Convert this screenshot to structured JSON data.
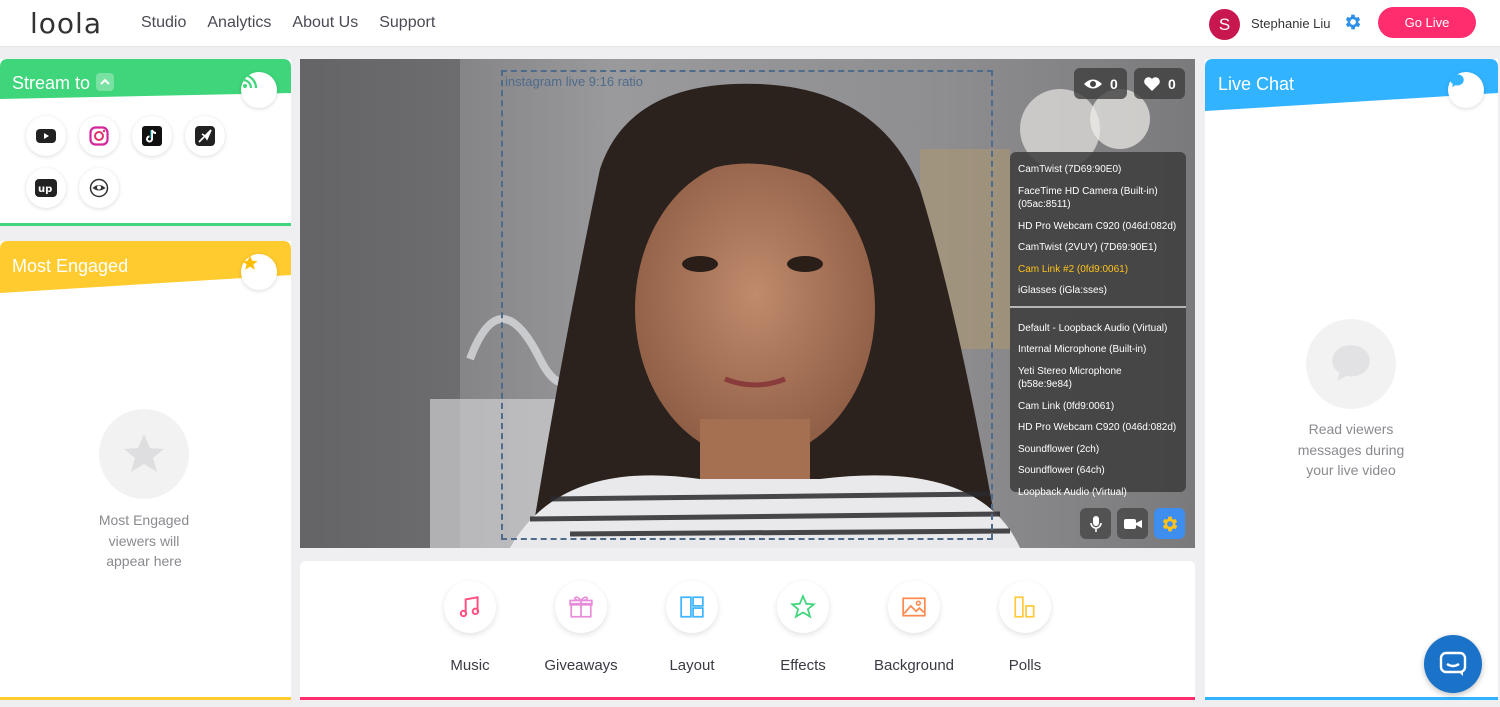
{
  "app": {
    "logo_text": "loola"
  },
  "nav": {
    "items": [
      "Studio",
      "Analytics",
      "About Us",
      "Support"
    ]
  },
  "user": {
    "initial": "S",
    "name": "Stephanie Liu"
  },
  "header": {
    "go_live_label": "Go Live"
  },
  "stream_to": {
    "title": "Stream to",
    "platforms": [
      "youtube-icon",
      "instagram-icon",
      "tiktok-icon",
      "periscope-icon",
      "upclose-icon",
      "eye-icon"
    ]
  },
  "most_engaged": {
    "title": "Most Engaged",
    "empty_text": "Most Engaged viewers will appear here"
  },
  "live_chat": {
    "title": "Live Chat",
    "empty_text": "Read viewers messages during your live video"
  },
  "video": {
    "ratio_label": "instagram live 9:16 ratio",
    "viewers": "0",
    "likes": "0",
    "video_devices": [
      "CamTwist (7D69:90E0)",
      "FaceTime HD Camera (Built-in) (05ac:8511)",
      "HD Pro Webcam C920 (046d:082d)",
      "CamTwist (2VUY) (7D69:90E1)",
      "Cam Link #2 (0fd9:0061)",
      "iGlasses (iGla:sses)"
    ],
    "selected_video_device": "Cam Link #2 (0fd9:0061)",
    "audio_devices": [
      "Default - Loopback Audio (Virtual)",
      "Internal Microphone (Built-in)",
      "Yeti Stereo Microphone (b58e:9e84)",
      "Cam Link (0fd9:0061)",
      "HD Pro Webcam C920 (046d:082d)",
      "Soundflower (2ch)",
      "Soundflower (64ch)",
      "Loopback Audio (Virtual)"
    ]
  },
  "tools": [
    "Music",
    "Giveaways",
    "Layout",
    "Effects",
    "Background",
    "Polls"
  ],
  "colors": {
    "green": "#3fd57a",
    "yellow": "#ffcb2e",
    "blue": "#31b3ff",
    "pink": "#ff2d6e",
    "selected_device": "#ffc21a"
  }
}
